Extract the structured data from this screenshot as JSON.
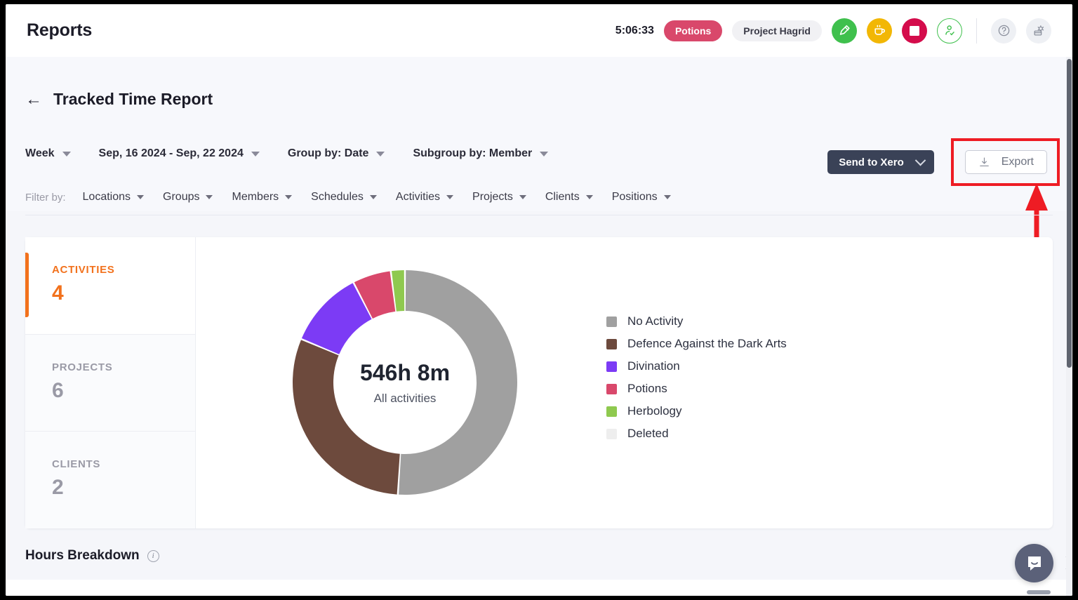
{
  "topbar": {
    "title": "Reports",
    "timer": "5:06:33",
    "activity_pill": "Potions",
    "project_pill": "Project Hagrid",
    "icons": [
      {
        "name": "start-timer-icon",
        "color": "#3fc04d"
      },
      {
        "name": "break-coffee-icon",
        "color": "#f2b705"
      },
      {
        "name": "stop-timer-icon",
        "color": "#d40c4b"
      },
      {
        "name": "user-check-icon",
        "color": "#3fc04d"
      },
      {
        "name": "help-icon",
        "color": "#eef0f4"
      },
      {
        "name": "settings-icon",
        "color": "#eef0f4"
      }
    ]
  },
  "report": {
    "back_label": "←",
    "title": "Tracked Time Report",
    "controls": [
      {
        "label": "Week",
        "name": "period-selector"
      },
      {
        "label": "Sep, 16 2024 - Sep, 22 2024",
        "name": "date-range-selector"
      },
      {
        "label": "Group by: Date",
        "name": "group-by-selector"
      },
      {
        "label": "Subgroup by: Member",
        "name": "subgroup-by-selector"
      }
    ],
    "send_to_xero": "Send to Xero",
    "export": "Export"
  },
  "filters": {
    "label": "Filter by:",
    "items": [
      "Locations",
      "Groups",
      "Members",
      "Schedules",
      "Activities",
      "Projects",
      "Clients",
      "Positions"
    ]
  },
  "stats": [
    {
      "label": "ACTIVITIES",
      "value": "4",
      "active": true
    },
    {
      "label": "PROJECTS",
      "value": "6",
      "active": false
    },
    {
      "label": "CLIENTS",
      "value": "2",
      "active": false
    }
  ],
  "chart_data": {
    "type": "pie",
    "title": "All activities",
    "center_total": "546h 8m",
    "center_subtitle": "All activities",
    "legend_position": "right",
    "categories": [
      "No Activity",
      "Defence Against the Dark Arts",
      "Divination",
      "Potions",
      "Herbology",
      "Deleted"
    ],
    "values": [
      50.5,
      30.0,
      11.0,
      5.5,
      2.0,
      0.0
    ],
    "value_unit": "percent",
    "colors": [
      "#a0a0a0",
      "#6d4a3d",
      "#7c3bf5",
      "#d9486b",
      "#8fc94f",
      "#eeeeee"
    ],
    "legend": [
      {
        "label": "No Activity",
        "color": "#a0a0a0"
      },
      {
        "label": "Defence Against the Dark Arts",
        "color": "#6d4a3d"
      },
      {
        "label": "Divination",
        "color": "#7c3bf5"
      },
      {
        "label": "Potions",
        "color": "#d9486b"
      },
      {
        "label": "Herbology",
        "color": "#8fc94f"
      },
      {
        "label": "Deleted",
        "color": "#eeeeee"
      }
    ]
  },
  "hours_breakdown": {
    "title": "Hours Breakdown",
    "info": "i"
  },
  "annotation": {
    "highlight_color": "#ee1c24",
    "target": "Export"
  },
  "chat": {
    "bubble": "chat-bubble-icon"
  }
}
